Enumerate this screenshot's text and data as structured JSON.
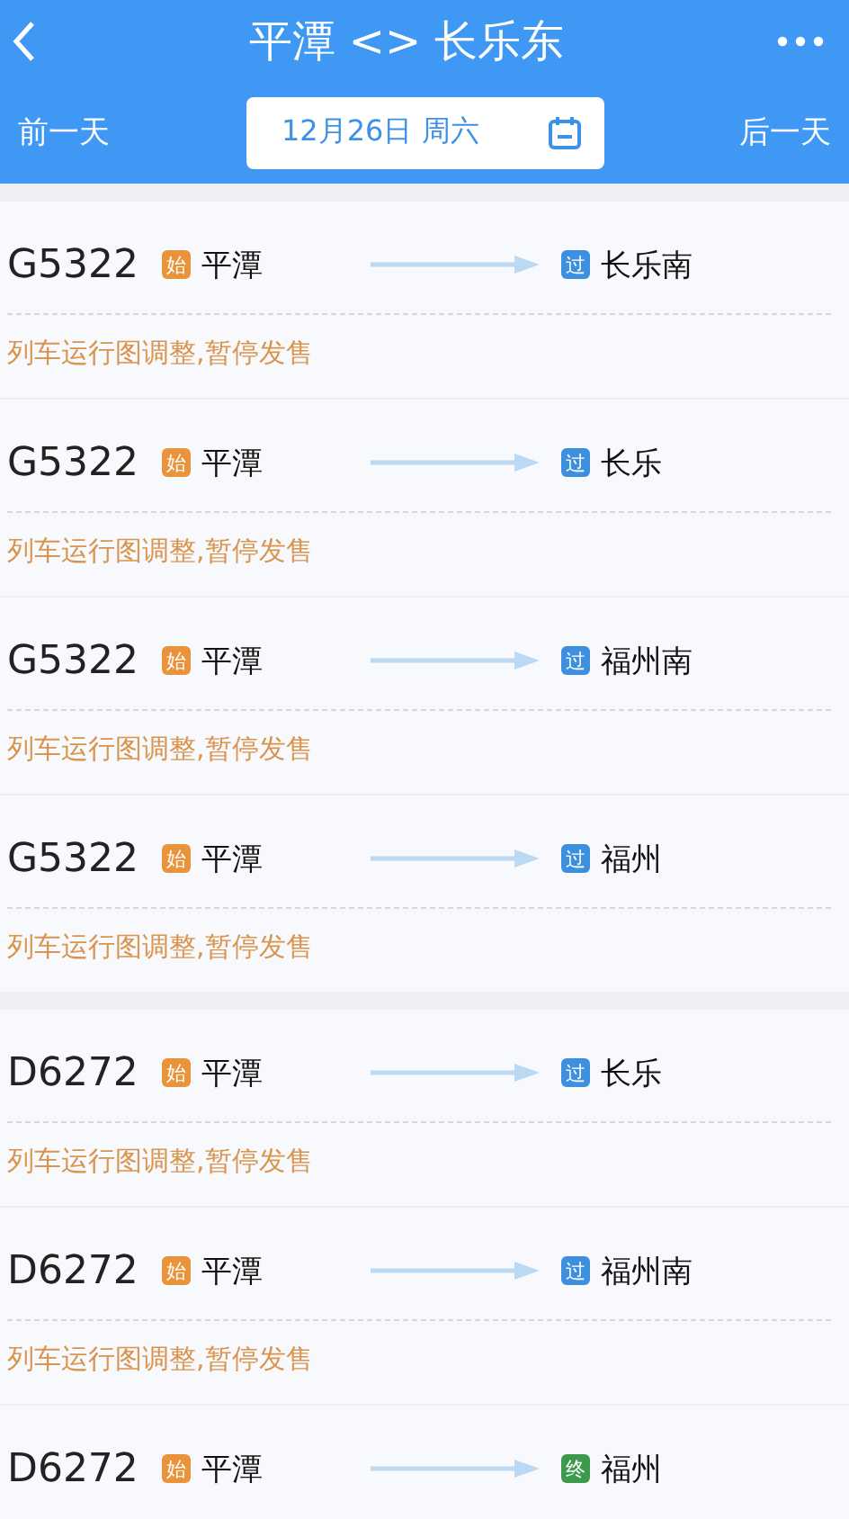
{
  "header": {
    "title": "平潭 <> 长乐东"
  },
  "date_bar": {
    "prev": "前一天",
    "date": "12月26日 周六",
    "next": "后一天"
  },
  "groups": [
    {
      "trains": [
        {
          "number": "G5322",
          "from_badge": {
            "text": "始",
            "kind": "start"
          },
          "from": "平潭",
          "to_badge": {
            "text": "过",
            "kind": "pass"
          },
          "to": "长乐南",
          "note": "列车运行图调整,暂停发售"
        },
        {
          "number": "G5322",
          "from_badge": {
            "text": "始",
            "kind": "start"
          },
          "from": "平潭",
          "to_badge": {
            "text": "过",
            "kind": "pass"
          },
          "to": "长乐",
          "note": "列车运行图调整,暂停发售"
        },
        {
          "number": "G5322",
          "from_badge": {
            "text": "始",
            "kind": "start"
          },
          "from": "平潭",
          "to_badge": {
            "text": "过",
            "kind": "pass"
          },
          "to": "福州南",
          "note": "列车运行图调整,暂停发售"
        },
        {
          "number": "G5322",
          "from_badge": {
            "text": "始",
            "kind": "start"
          },
          "from": "平潭",
          "to_badge": {
            "text": "过",
            "kind": "pass"
          },
          "to": "福州",
          "note": "列车运行图调整,暂停发售"
        }
      ]
    },
    {
      "trains": [
        {
          "number": "D6272",
          "from_badge": {
            "text": "始",
            "kind": "start"
          },
          "from": "平潭",
          "to_badge": {
            "text": "过",
            "kind": "pass"
          },
          "to": "长乐",
          "note": "列车运行图调整,暂停发售"
        },
        {
          "number": "D6272",
          "from_badge": {
            "text": "始",
            "kind": "start"
          },
          "from": "平潭",
          "to_badge": {
            "text": "过",
            "kind": "pass"
          },
          "to": "福州南",
          "note": "列车运行图调整,暂停发售"
        },
        {
          "number": "D6272",
          "from_badge": {
            "text": "始",
            "kind": "start"
          },
          "from": "平潭",
          "to_badge": {
            "text": "终",
            "kind": "end"
          },
          "to": "福州"
        }
      ]
    }
  ]
}
